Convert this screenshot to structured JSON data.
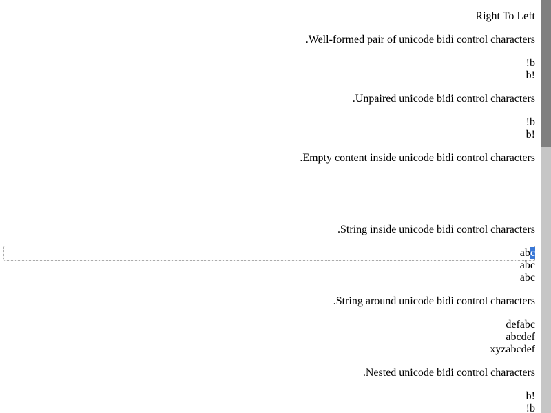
{
  "heading": "Right To Left",
  "sections": [
    {
      "caption": "Well-formed pair of unicode bidi control characters.",
      "lines": [
        "b!",
        "b!"
      ]
    },
    {
      "caption": "Unpaired unicode bidi control characters.",
      "lines": [
        "b!",
        "b!"
      ]
    },
    {
      "caption": "Empty content inside unicode bidi control characters.",
      "lines": []
    },
    {
      "caption": "String inside unicode bidi control characters.",
      "selected_line": {
        "before": "ab",
        "selected": "c"
      },
      "lines": [
        "abc",
        "abc"
      ]
    },
    {
      "caption": "String around unicode bidi control characters.",
      "lines": [
        "defabc",
        "abcdef",
        "xyzabcdef"
      ]
    },
    {
      "caption": "Nested unicode bidi control characters.",
      "lines": [
        "b!",
        "b!"
      ]
    }
  ]
}
